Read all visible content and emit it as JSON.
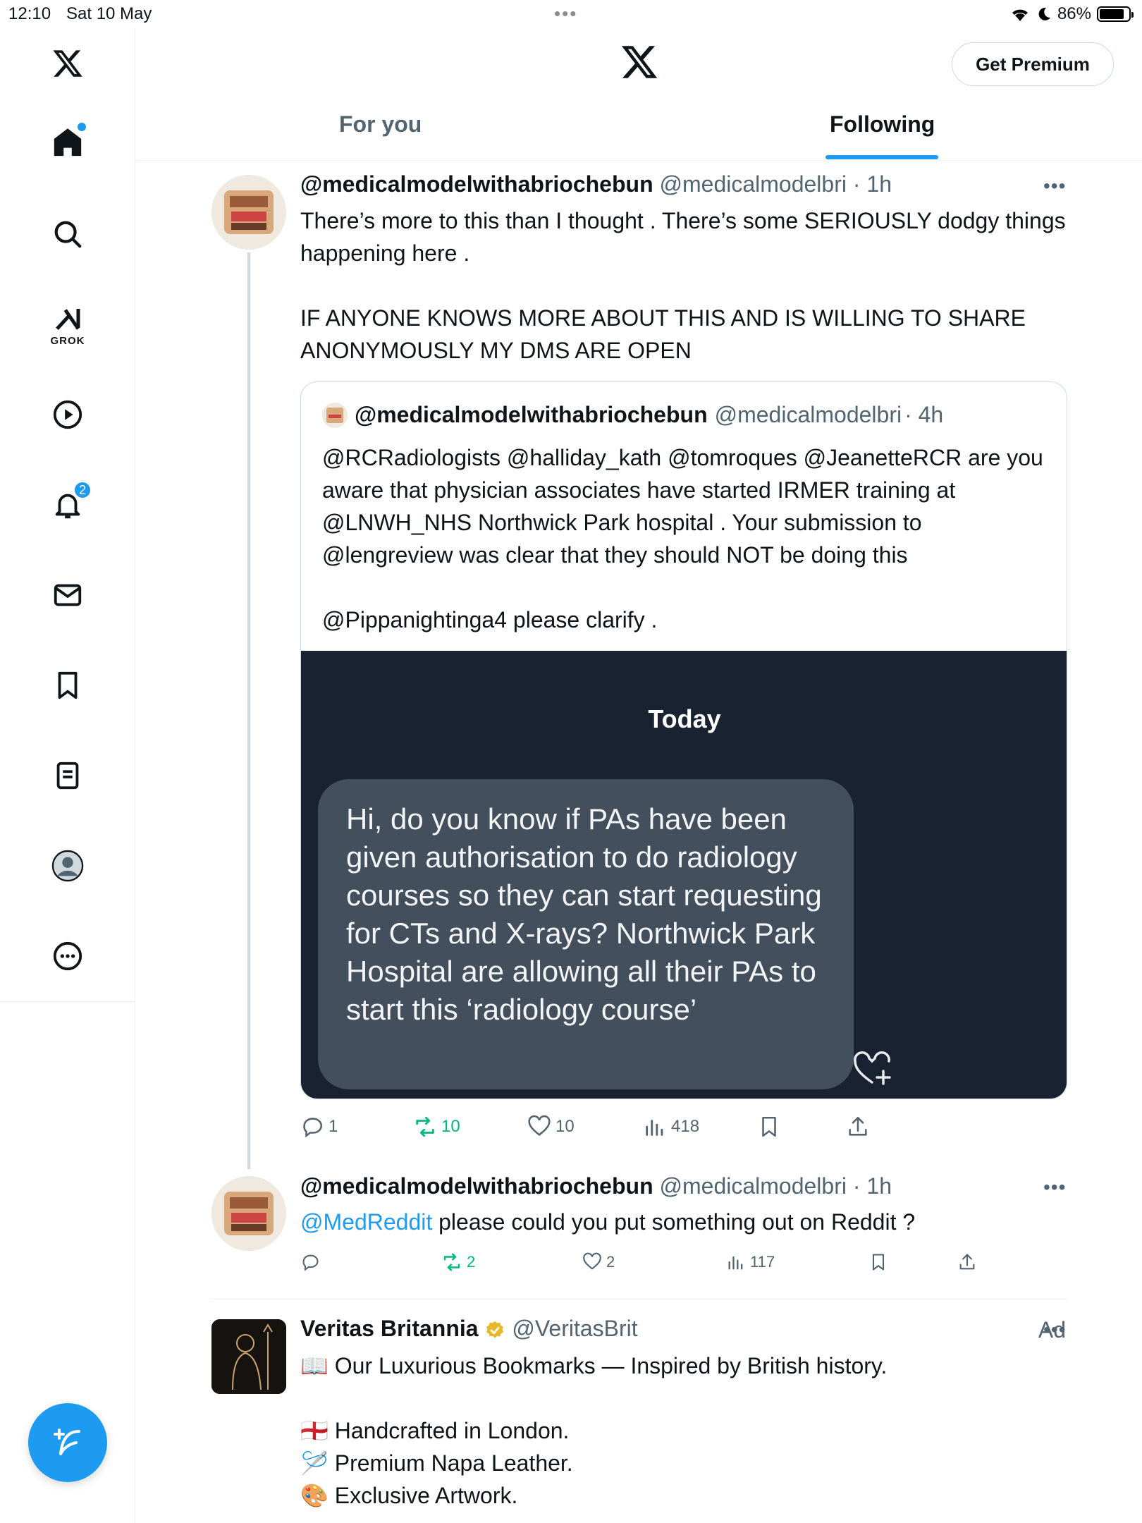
{
  "status_bar": {
    "time": "12:10",
    "date": "Sat 10 May",
    "battery": "86%",
    "battery_level": 0.86
  },
  "header": {
    "premium_label": "Get Premium",
    "tabs": [
      {
        "label": "For you",
        "active": false
      },
      {
        "label": "Following",
        "active": true
      }
    ]
  },
  "sidebar": {
    "grok_label": "GROK",
    "notifications_count": "2",
    "items": [
      "home-icon",
      "search-icon",
      "grok-icon",
      "video-icon",
      "bell-icon",
      "mail-icon",
      "bookmark-icon",
      "lists-icon",
      "profile-icon",
      "more-icon"
    ]
  },
  "tweet1": {
    "name": "@medicalmodelwithabriochebun",
    "handle": "@medicalmodelbri",
    "time": "· 1h",
    "text": "There’s more to this than I thought . There’s some SERIOUSLY dodgy things happening here .\n\nIF ANYONE KNOWS MORE ABOUT THIS AND IS WILLING TO SHARE ANONYMOUSLY MY DMS ARE OPEN",
    "quote": {
      "name": "@medicalmodelwithabriochebun",
      "handle": "@medicalmodelbri",
      "time": "· 4h",
      "text": "@RCRadiologists @halliday_kath @tomroques @JeanetteRCR are you aware that physician associates have started IRMER training at @LNWH_NHS Northwick Park hospital . Your submission to @lengreview was clear that they should NOT be doing this\n\n@Pippanightinga4 please clarify .",
      "media_header": "Today",
      "media_message": "Hi, do you know if PAs have been given authorisation to do radiology courses so they can start requesting for CTs and X-rays? Northwick Park Hospital are allowing all their PAs to start this ‘radiology course’"
    },
    "replies": "1",
    "reposts": "10",
    "likes": "10",
    "views": "418"
  },
  "tweet2": {
    "name": "@medicalmodelwithabriochebun",
    "handle": "@medicalmodelbri",
    "time": "· 1h",
    "mention": "@MedReddit",
    "text": " please could you put something out on Reddit ?",
    "replies": "",
    "reposts": "2",
    "likes": "2",
    "views": "117"
  },
  "ad": {
    "name": "Veritas Britannia",
    "handle": "@VeritasBrit",
    "label": "Ad",
    "line1": "📖 Our Luxurious Bookmarks — Inspired by British history.",
    "line2": "🏴󠁧󠁢󠁥󠁮󠁧󠁿 Handcrafted in London.",
    "line3": "🪡 Premium Napa Leather.",
    "line4": "🎨 Exclusive Artwork."
  },
  "colors": {
    "accent": "#1d9bf0",
    "repost_green": "#00ba7c",
    "secondary_text": "#536471",
    "media_bg": "#182230",
    "bubble_bg": "#434f5c"
  }
}
